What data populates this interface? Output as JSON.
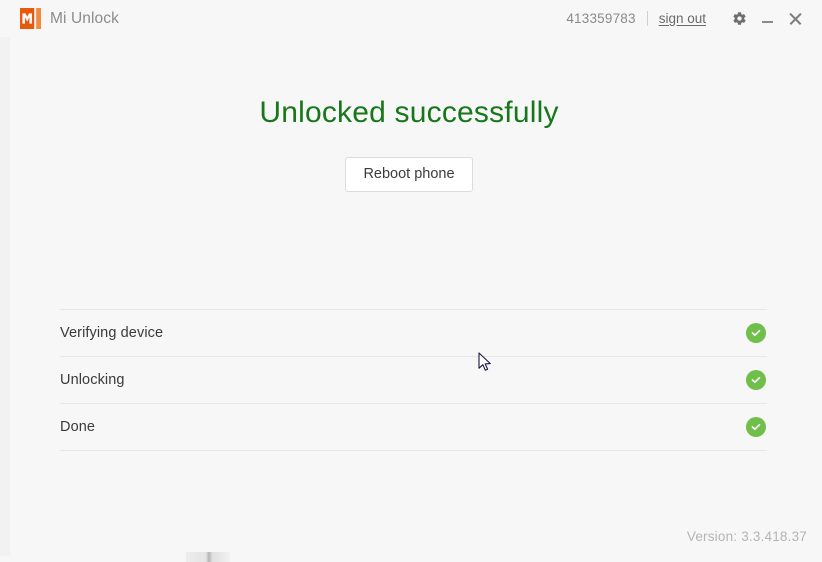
{
  "window": {
    "app_name": "Mi Unlock",
    "logo_text": "MI",
    "logo_color": "#ff6700"
  },
  "titlebar": {
    "account_id": "413359783",
    "sign_out_label": "sign out",
    "settings_icon": "gear-icon",
    "minimize_icon": "minimize-icon",
    "close_icon": "close-icon"
  },
  "main": {
    "status_title": "Unlocked successfully",
    "status_color": "#18761b",
    "reboot_button_label": "Reboot phone"
  },
  "steps": [
    {
      "label": "Verifying device",
      "state_icon": "check-circle-icon",
      "state_color": "#70bf4b"
    },
    {
      "label": "Unlocking",
      "state_icon": "check-circle-icon",
      "state_color": "#70bf4b"
    },
    {
      "label": "Done",
      "state_icon": "check-circle-icon",
      "state_color": "#70bf4b"
    }
  ],
  "footer": {
    "version_text": "Version: 3.3.418.37"
  }
}
